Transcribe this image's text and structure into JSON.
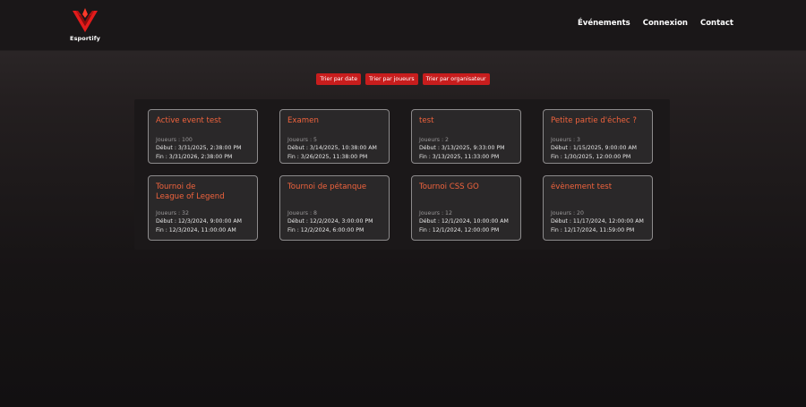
{
  "brand": {
    "name": "Esportify"
  },
  "nav": [
    {
      "label": "Événements"
    },
    {
      "label": "Connexion"
    },
    {
      "label": "Contact"
    }
  ],
  "sort_buttons": [
    {
      "label": "Trier par date"
    },
    {
      "label": "Trier par joueurs"
    },
    {
      "label": "Trier par organisateur"
    }
  ],
  "colors": {
    "accent_red": "#c81d1d",
    "title_orange": "#f0633d"
  },
  "events": [
    {
      "title": "Active event test",
      "players": "Joueurs : 100",
      "start": "Début : 3/31/2025, 2:38:00 PM",
      "end": "Fin : 3/31/2026, 2:38:00 PM"
    },
    {
      "title": "Examen",
      "players": "Joueurs : 5",
      "start": "Début : 3/14/2025, 10:38:00 AM",
      "end": "Fin : 3/26/2025, 11:38:00 PM"
    },
    {
      "title": "test",
      "players": "Joueurs : 2",
      "start": "Début : 3/13/2025, 9:33:00 PM",
      "end": "Fin : 3/13/2025, 11:33:00 PM"
    },
    {
      "title": "Petite partie d'échec ?",
      "players": "Joueurs : 3",
      "start": "Début : 1/15/2025, 9:00:00 AM",
      "end": "Fin : 1/30/2025, 12:00:00 PM"
    },
    {
      "title": "Tournoi de\nLeague of Legend",
      "players": "Joueurs : 32",
      "start": "Début : 12/3/2024, 9:00:00 AM",
      "end": "Fin : 12/3/2024, 11:00:00 AM"
    },
    {
      "title": "Tournoi de pétanque",
      "players": "Joueurs : 8",
      "start": "Début : 12/2/2024, 3:00:00 PM",
      "end": "Fin : 12/2/2024, 6:00:00 PM"
    },
    {
      "title": "Tournoi CSS GO",
      "players": "Joueurs : 12",
      "start": "Début : 12/1/2024, 10:00:00 AM",
      "end": "Fin : 12/1/2024, 12:00:00 PM"
    },
    {
      "title": "évènement test",
      "players": "Joueurs : 20",
      "start": "Début : 11/17/2024, 12:00:00 AM",
      "end": "Fin : 12/17/2024, 11:59:00 PM"
    }
  ]
}
